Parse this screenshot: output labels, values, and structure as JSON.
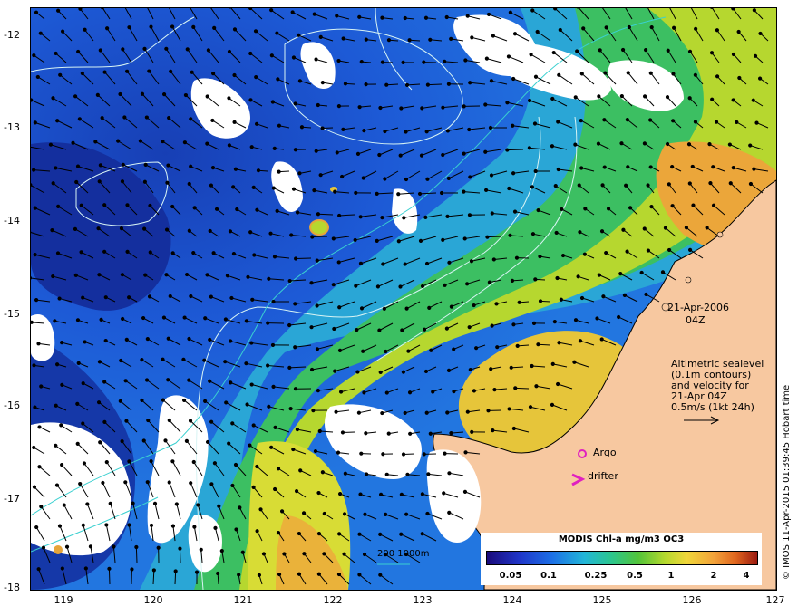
{
  "map": {
    "date_label": "21-Apr-2006",
    "time_label": "04Z",
    "legend_lines": [
      "Altimetric sealevel",
      "(0.1m contours)",
      "and velocity for",
      "21-Apr 04Z",
      "0.5m/s (1kt 24h)"
    ],
    "argo_label": "Argo",
    "drifter_label": "drifter",
    "depth_label": "200  1000m",
    "credit": "© IMOS 11-Apr-2015 01:39:45 Hobart time",
    "y_axis_labels": [
      "-12",
      "-13",
      "-14",
      "-15",
      "-16",
      "-17",
      "-18"
    ],
    "x_axis_labels": [
      "119",
      "120",
      "121",
      "122",
      "123",
      "124",
      "125",
      "126",
      "127"
    ],
    "colors": {
      "land": "#f7c8a0",
      "cloud": "#ffffff",
      "argo_marker": "#e020c0",
      "contour": "#d8f4f4",
      "isobath": "#3ad0d0"
    }
  },
  "colorbar": {
    "title": "MODIS Chl-a mg/m3 OC3",
    "ticks": [
      "0.05",
      "0.1",
      "0.25",
      "0.5",
      "1",
      "2",
      "4"
    ]
  }
}
